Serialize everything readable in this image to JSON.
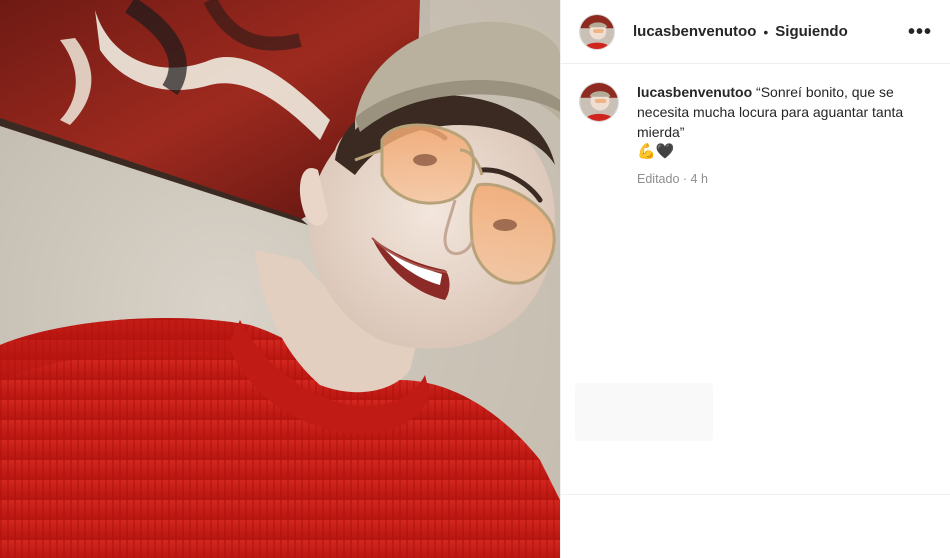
{
  "post": {
    "author": {
      "username": "lucasbenvenutoo",
      "follow_status": "Siguiendo"
    },
    "header": {
      "separator": "•",
      "more_icon": "more-horizontal-icon",
      "more_glyph": "•••"
    },
    "caption": {
      "username": "lucasbenvenutoo",
      "text": "“Sonreí bonito, que se necesita mucha locura para aguantar tanta mierda”",
      "emojis": "💪🖤",
      "edited_label": "Editado",
      "time_separator": "·",
      "timestamp": "4 h"
    },
    "photo": {
      "icon": "selfie-photo"
    }
  },
  "colors": {
    "text": "#262626",
    "secondary": "#8e8e8e",
    "border": "#efefef",
    "sweater": "#d0241f"
  }
}
